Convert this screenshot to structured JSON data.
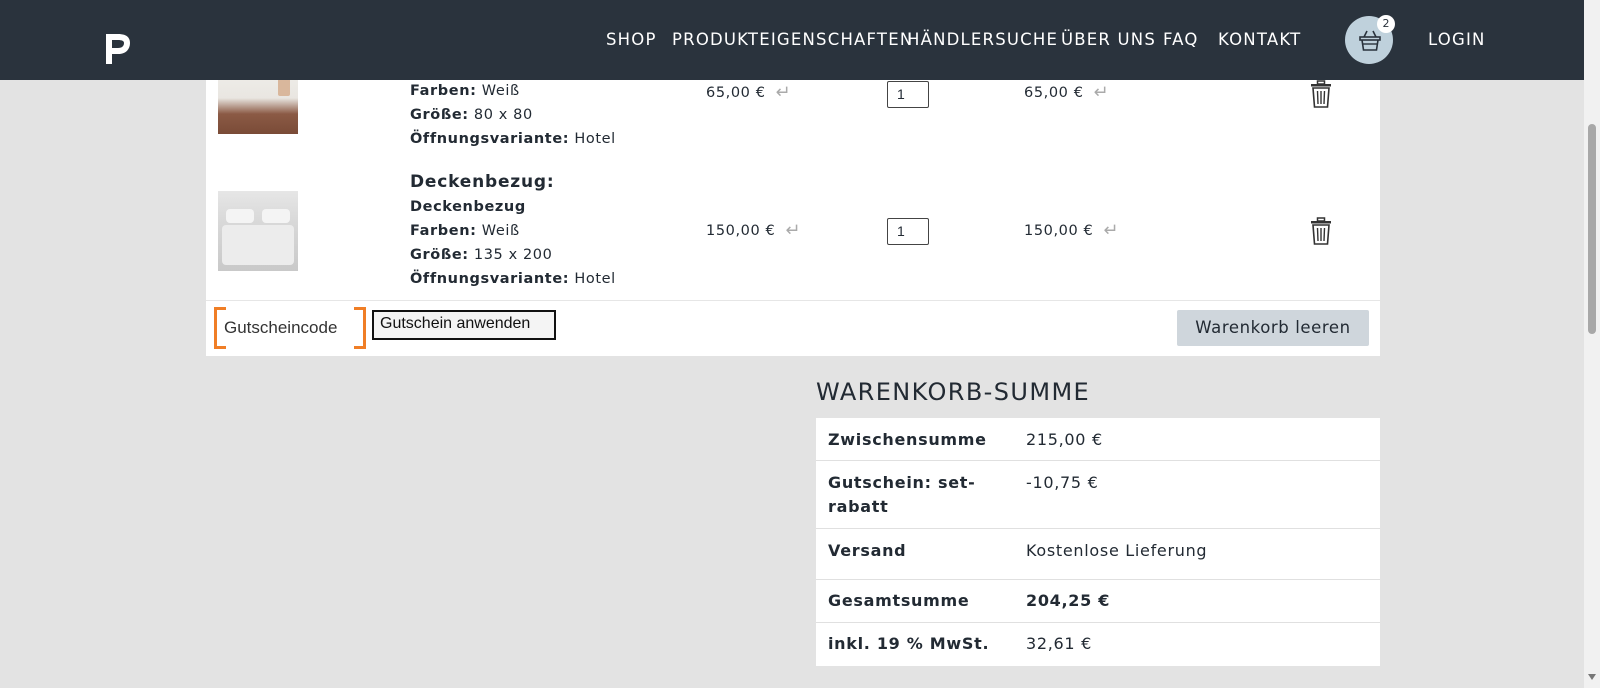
{
  "header": {
    "nav": [
      "SHOP",
      "PRODUKTEIGENSCHAFTEN",
      "HÄNDLERSUCHE",
      "ÜBER UNS",
      "FAQ",
      "KONTAKT"
    ],
    "cart_count": "2",
    "login": "LOGIN"
  },
  "cart": {
    "items": [
      {
        "colors_label": "Farben:",
        "colors": "Weiß",
        "size_label": "Größe:",
        "size": "80 x 80",
        "opening_label": "Öffnungsvariante:",
        "opening": "Hotel",
        "price": "65,00 €",
        "quantity": "1",
        "subtotal": "65,00 €"
      },
      {
        "title": "Deckenbezug:",
        "name": "Deckenbezug",
        "colors_label": "Farben:",
        "colors": "Weiß",
        "size_label": "Größe:",
        "size": "135 x 200",
        "opening_label": "Öffnungsvariante:",
        "opening": "Hotel",
        "price": "150,00 €",
        "quantity": "1",
        "subtotal": "150,00 €"
      }
    ],
    "coupon_placeholder": "Gutscheincode",
    "coupon_button": "Gutschein anwenden",
    "clear_button": "Warenkorb leeren"
  },
  "totals": {
    "title": "WARENKORB-SUMME",
    "rows": [
      {
        "label": "Zwischensumme",
        "value": "215,00 €"
      },
      {
        "label": "Gutschein: set-rabatt",
        "value": "-10,75 €"
      },
      {
        "label": "Versand",
        "value": "Kostenlose Lieferung"
      },
      {
        "label": "Gesamtsumme",
        "value": "204,25 €"
      },
      {
        "label": "inkl. 19 % MwSt.",
        "value": "32,61 €"
      }
    ]
  },
  "icons": {
    "logo": "brand-logo",
    "cart": "shopping-basket-icon",
    "remove": "trash-icon",
    "return": "return-arrow-icon"
  },
  "colors": {
    "header_bg": "#2a333d",
    "page_bg": "#e3e3e3",
    "focus_outline": "#f07e26",
    "clear_button_bg": "#cfd6dc",
    "cart_button_bg": "#bfd1dc"
  }
}
